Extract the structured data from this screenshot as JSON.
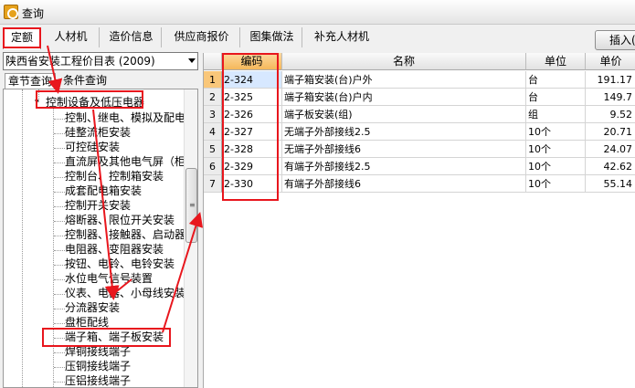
{
  "window": {
    "title": "查询"
  },
  "tabs": [
    "定额",
    "人材机",
    "造价信息",
    "供应商报价",
    "图集做法",
    "补充人材机"
  ],
  "toolbar": {
    "insert_label": "插入("
  },
  "library": {
    "selected": "陕西省安装工程价目表 (2009)"
  },
  "subtabs": {
    "chapter": "章节查询",
    "condition": "条件查询"
  },
  "tree": {
    "parent": "控制设备及低压电器",
    "children": [
      "控制、继电、模拟及配电",
      "硅整流柜安装",
      "可控硅安装",
      "直流屏及其他电气屏（柜",
      "控制台、控制箱安装",
      "成套配电箱安装",
      "控制开关安装",
      "熔断器、限位开关安装",
      "控制器、接触器、启动器",
      "电阻器、变阻器安装",
      "按钮、电铃、电铃安装",
      "水位电气信号装置",
      "仪表、电器、小母线安装",
      "分流器安装",
      "盘柜配线",
      "端子箱、端子板安装",
      "焊铜接线端子",
      "压铜接线端子",
      "压铝接线端子"
    ],
    "selected_index": 15
  },
  "grid": {
    "columns": [
      "编码",
      "名称",
      "单位",
      "单价"
    ],
    "rows": [
      {
        "n": "1",
        "code": "2-324",
        "name": "端子箱安装(台)户外",
        "unit": "台",
        "price": "191.17"
      },
      {
        "n": "2",
        "code": "2-325",
        "name": "端子箱安装(台)户内",
        "unit": "台",
        "price": "149.7"
      },
      {
        "n": "3",
        "code": "2-326",
        "name": "端子板安装(组)",
        "unit": "组",
        "price": "9.52"
      },
      {
        "n": "4",
        "code": "2-327",
        "name": "无端子外部接线2.5",
        "unit": "10个",
        "price": "20.71"
      },
      {
        "n": "5",
        "code": "2-328",
        "name": "无端子外部接线6",
        "unit": "10个",
        "price": "24.07"
      },
      {
        "n": "6",
        "code": "2-329",
        "name": "有端子外部接线2.5",
        "unit": "10个",
        "price": "42.62"
      },
      {
        "n": "7",
        "code": "2-330",
        "name": "有端子外部接线6",
        "unit": "10个",
        "price": "55.14"
      }
    ]
  },
  "colors": {
    "annotation": "#e8161d",
    "row_selected": "#f9c77a"
  }
}
